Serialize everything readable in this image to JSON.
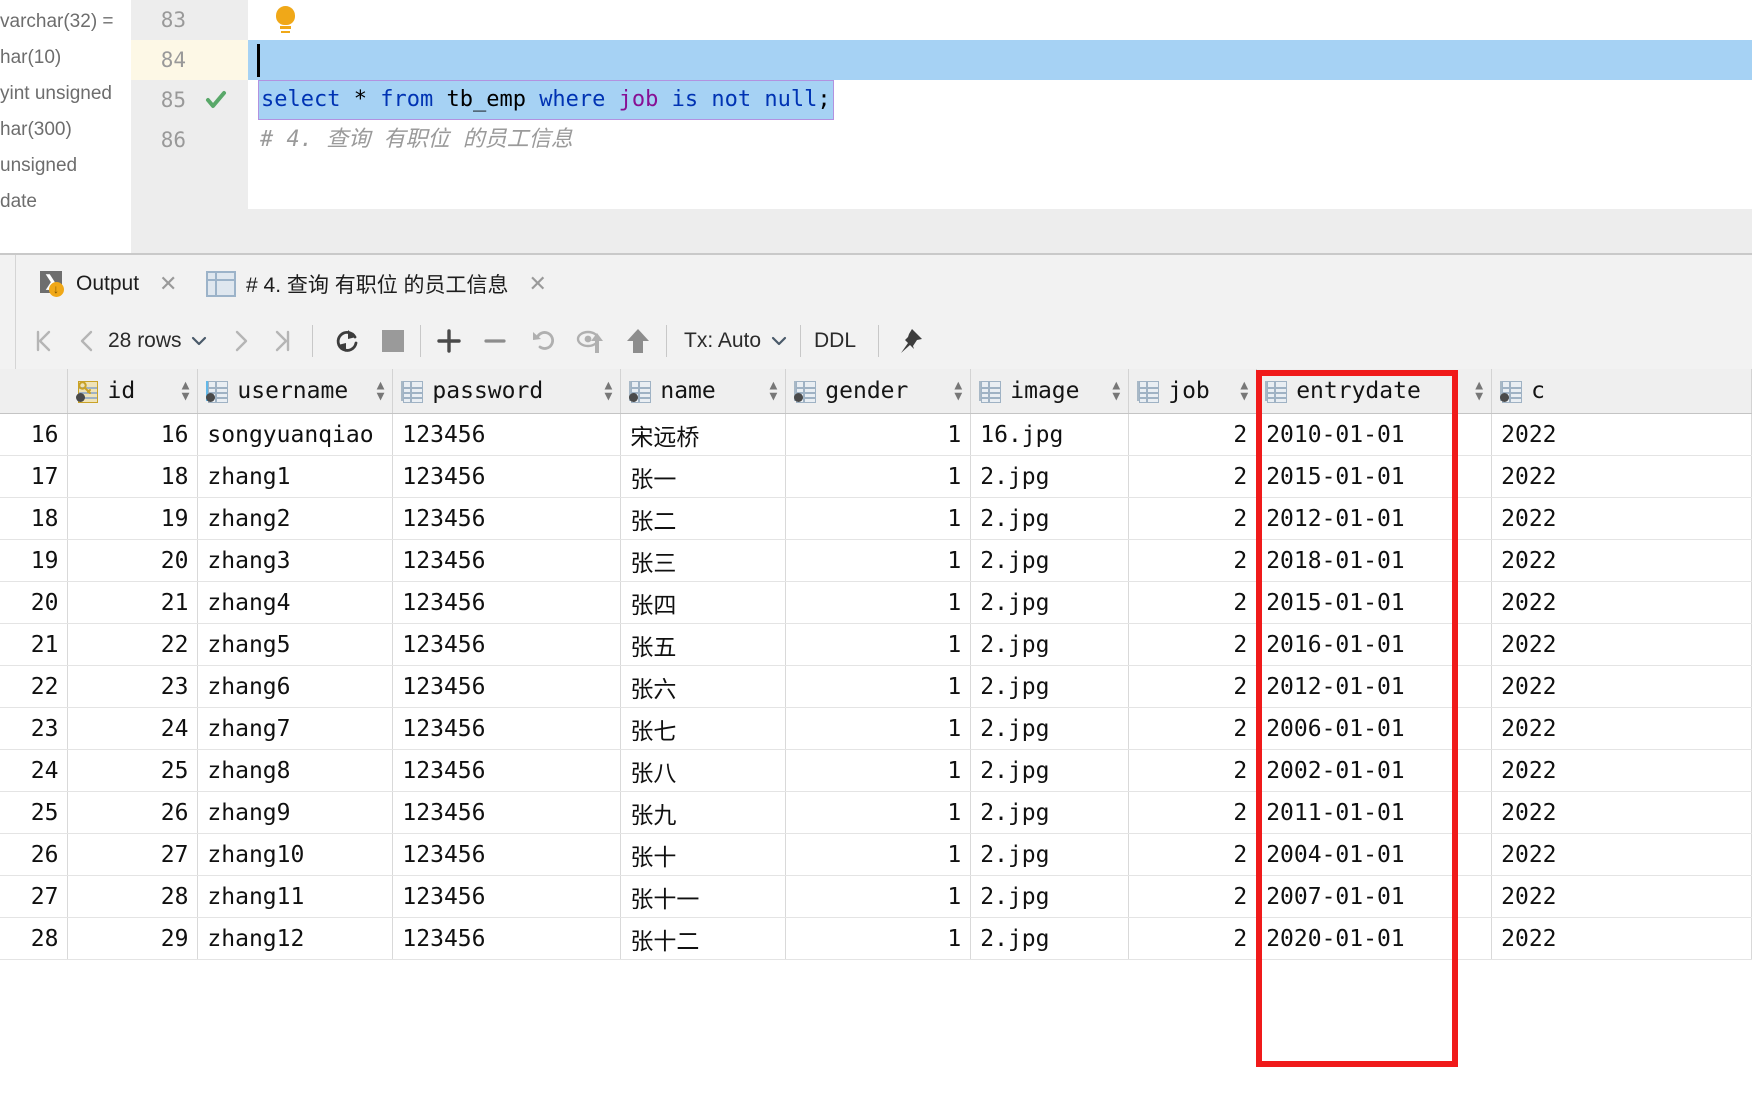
{
  "editor": {
    "completion_hints": [
      "varchar(32) = ",
      "har(10)",
      "yint unsigned",
      "har(300)",
      "unsigned",
      "date"
    ],
    "gutter_lines": [
      "83",
      "84",
      "85",
      "86"
    ],
    "executed_line": "85",
    "comment_line": "# 4. 查询 有职位 的员工信息",
    "sql": {
      "select": "select",
      "star": " * ",
      "from": "from",
      "table": " tb_emp ",
      "where": "where",
      "field": " job ",
      "is_not_null": "is not null",
      "semicolon": ";"
    },
    "sql_plain": "select * from tb_emp where job is not null;",
    "bulb_icon": "intention-bulb-icon",
    "check_icon": "green-check-icon"
  },
  "tabs": {
    "output": {
      "label": "Output",
      "icon": "output-console-icon",
      "close": "✕"
    },
    "result": {
      "label": "# 4. 查询 有职位 的员工信息",
      "icon": "result-grid-icon",
      "close": "✕",
      "active": true
    }
  },
  "toolbar": {
    "first_page_icon": "first-page-icon",
    "prev_page_icon": "previous-page-icon",
    "rows_label": "28 rows",
    "rows_chevron": "chevron-down-icon",
    "next_page_icon": "next-page-icon",
    "last_page_icon": "last-page-icon",
    "reload_icon": "reload-page-icon",
    "stop_icon": "stop-icon",
    "add_row_icon": "add-row-icon",
    "delete_row_icon": "delete-row-icon",
    "revert_icon": "revert-changes-icon",
    "find_submit_icon": "submit-and-commit-icon",
    "submit_icon": "submit-icon",
    "tx_label": "Tx: Auto",
    "tx_chevron": "chevron-down-icon",
    "ddl_label": "DDL",
    "pin_icon": "pin-tab-icon"
  },
  "table": {
    "columns": [
      {
        "name": "id",
        "icon": "primary-key-column-icon",
        "align": "num"
      },
      {
        "name": "username",
        "icon": "indexed-column-icon",
        "align": "txt"
      },
      {
        "name": "password",
        "icon": "column-icon",
        "align": "txt"
      },
      {
        "name": "name",
        "icon": "notnull-column-icon",
        "align": "txt"
      },
      {
        "name": "gender",
        "icon": "notnull-column-icon",
        "align": "num"
      },
      {
        "name": "image",
        "icon": "column-icon",
        "align": "txt"
      },
      {
        "name": "job",
        "icon": "column-icon",
        "align": "num"
      },
      {
        "name": "entrydate",
        "icon": "column-icon",
        "align": "txt"
      },
      {
        "name": "c",
        "icon": "notnull-column-icon",
        "align": "txt"
      }
    ],
    "sort_icon": "sort-arrows-icon",
    "rows": [
      {
        "n": "16",
        "id": "16",
        "username": "songyuanqiao",
        "password": "123456",
        "name": "宋远桥",
        "gender": "1",
        "image": "16.jpg",
        "job": "2",
        "entrydate": "2010-01-01",
        "c": "2022"
      },
      {
        "n": "17",
        "id": "18",
        "username": "zhang1",
        "password": "123456",
        "name": "张一",
        "gender": "1",
        "image": "2.jpg",
        "job": "2",
        "entrydate": "2015-01-01",
        "c": "2022"
      },
      {
        "n": "18",
        "id": "19",
        "username": "zhang2",
        "password": "123456",
        "name": "张二",
        "gender": "1",
        "image": "2.jpg",
        "job": "2",
        "entrydate": "2012-01-01",
        "c": "2022"
      },
      {
        "n": "19",
        "id": "20",
        "username": "zhang3",
        "password": "123456",
        "name": "张三",
        "gender": "1",
        "image": "2.jpg",
        "job": "2",
        "entrydate": "2018-01-01",
        "c": "2022"
      },
      {
        "n": "20",
        "id": "21",
        "username": "zhang4",
        "password": "123456",
        "name": "张四",
        "gender": "1",
        "image": "2.jpg",
        "job": "2",
        "entrydate": "2015-01-01",
        "c": "2022"
      },
      {
        "n": "21",
        "id": "22",
        "username": "zhang5",
        "password": "123456",
        "name": "张五",
        "gender": "1",
        "image": "2.jpg",
        "job": "2",
        "entrydate": "2016-01-01",
        "c": "2022"
      },
      {
        "n": "22",
        "id": "23",
        "username": "zhang6",
        "password": "123456",
        "name": "张六",
        "gender": "1",
        "image": "2.jpg",
        "job": "2",
        "entrydate": "2012-01-01",
        "c": "2022"
      },
      {
        "n": "23",
        "id": "24",
        "username": "zhang7",
        "password": "123456",
        "name": "张七",
        "gender": "1",
        "image": "2.jpg",
        "job": "2",
        "entrydate": "2006-01-01",
        "c": "2022"
      },
      {
        "n": "24",
        "id": "25",
        "username": "zhang8",
        "password": "123456",
        "name": "张八",
        "gender": "1",
        "image": "2.jpg",
        "job": "2",
        "entrydate": "2002-01-01",
        "c": "2022"
      },
      {
        "n": "25",
        "id": "26",
        "username": "zhang9",
        "password": "123456",
        "name": "张九",
        "gender": "1",
        "image": "2.jpg",
        "job": "2",
        "entrydate": "2011-01-01",
        "c": "2022"
      },
      {
        "n": "26",
        "id": "27",
        "username": "zhang10",
        "password": "123456",
        "name": "张十",
        "gender": "1",
        "image": "2.jpg",
        "job": "2",
        "entrydate": "2004-01-01",
        "c": "2022"
      },
      {
        "n": "27",
        "id": "28",
        "username": "zhang11",
        "password": "123456",
        "name": "张十一",
        "gender": "1",
        "image": "2.jpg",
        "job": "2",
        "entrydate": "2007-01-01",
        "c": "2022"
      },
      {
        "n": "28",
        "id": "29",
        "username": "zhang12",
        "password": "123456",
        "name": "张十二",
        "gender": "1",
        "image": "2.jpg",
        "job": "2",
        "entrydate": "2020-01-01",
        "c": "2022"
      }
    ]
  },
  "annotation": {
    "shape": "rectangle",
    "color": "#f01a1a",
    "highlights_column": "job"
  },
  "colors": {
    "keyword": "#0033b3",
    "field": "#871094",
    "selection": "#a6d2f4",
    "annotation_red": "#f01a1a",
    "accent_orange": "#f0a818",
    "check_green": "#59a869"
  }
}
